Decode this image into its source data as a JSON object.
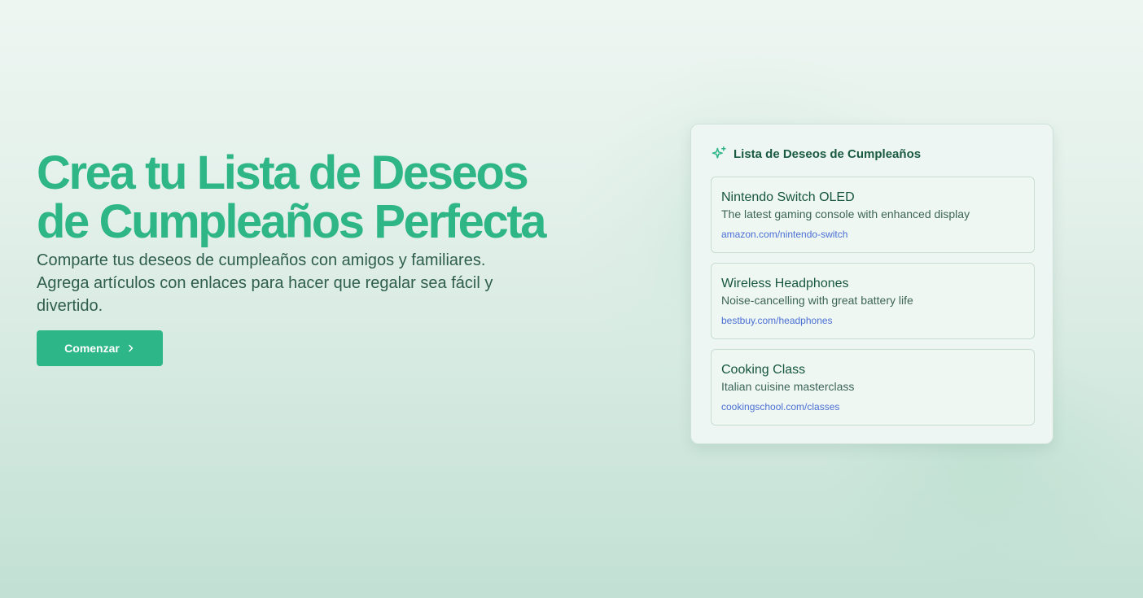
{
  "hero": {
    "title": "Crea tu Lista de Deseos de Cumpleaños Perfecta",
    "subtitle": "Comparte tus deseos de cumpleaños con amigos y familiares. Agrega artículos con enlaces para hacer que regalar sea fácil y divertido.",
    "cta_label": "Comenzar",
    "cta_icon": "chevron-right-icon"
  },
  "card": {
    "icon": "sparkles-icon",
    "title": "Lista de Deseos de Cumpleaños",
    "items": [
      {
        "name": "Nintendo Switch OLED",
        "description": "The latest gaming console with enhanced display",
        "link": "amazon.com/nintendo-switch"
      },
      {
        "name": "Wireless Headphones",
        "description": "Noise-cancelling with great battery life",
        "link": "bestbuy.com/headphones"
      },
      {
        "name": "Cooking Class",
        "description": "Italian cuisine masterclass",
        "link": "cookingschool.com/classes"
      }
    ]
  },
  "colors": {
    "accent": "#2eb687",
    "heading_dark": "#195a41",
    "body_text": "#2f5e4e",
    "link": "#4a6fd4",
    "background_top": "#eef6f2",
    "background_bottom": "#c2e0d4"
  }
}
